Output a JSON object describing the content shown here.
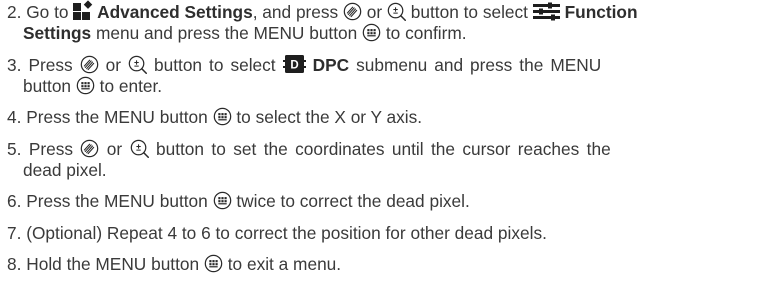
{
  "steps": [
    {
      "num": "2.",
      "t1": "Go to ",
      "adv": "Advanced Settings",
      "t2": ", and press ",
      "t3": " or ",
      "t4": " button to select ",
      "func": "Function",
      "func2": "Settings",
      "t5": " menu and press the MENU button ",
      "t6": " to confirm."
    },
    {
      "num": "3.",
      "t1": "Press ",
      "t2": " or ",
      "t3": " button to select ",
      "dpc": "DPC",
      "t4": " submenu and press the MENU",
      "t5": "button ",
      "t6": " to enter."
    },
    {
      "num": "4.",
      "t1": "Press the MENU button ",
      "t2": " to select the X or Y axis."
    },
    {
      "num": "5.",
      "t1": "Press ",
      "t2": " or ",
      "t3": " button to set the coordinates until the cursor reaches the",
      "t4": "dead pixel."
    },
    {
      "num": "6.",
      "t1": "Press the MENU button ",
      "t2": " twice to correct the dead pixel."
    },
    {
      "num": "7.",
      "t1": "(Optional) Repeat 4 to 6 to correct the position for other dead pixels."
    },
    {
      "num": "8.",
      "t1": "Hold the MENU button ",
      "t2": " to exit a menu."
    }
  ],
  "icons": {
    "advanced_settings": "advanced-settings-icon",
    "function_settings": "function-settings-icon",
    "dpc": "dpc-icon",
    "dpc_letter": "D",
    "focus_button": "focus-wheel-button-icon",
    "zoom_button": "zoom-button-icon",
    "zoom_label": "±",
    "menu_button": "menu-button-icon"
  },
  "colors": {
    "text": "#3a3a3a",
    "icon": "#1e1e1e"
  }
}
